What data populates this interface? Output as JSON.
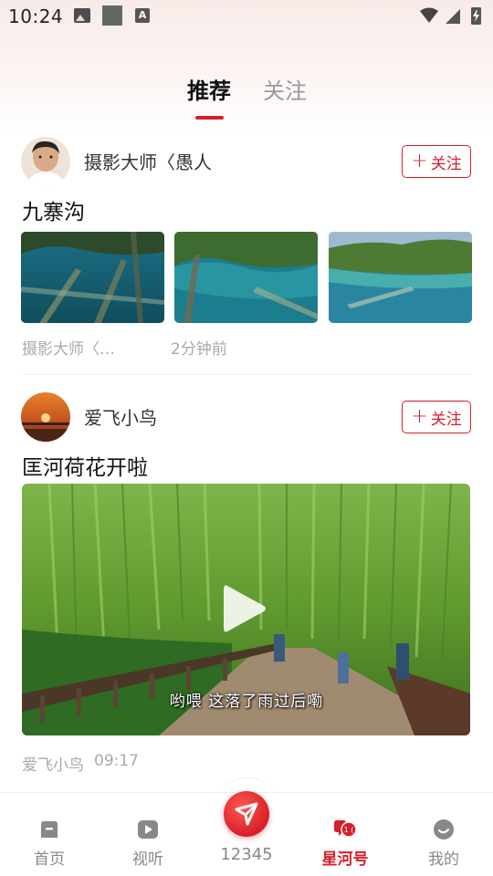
{
  "status_bar": {
    "time": "10:24"
  },
  "tabs": [
    {
      "label": "推荐",
      "active": true
    },
    {
      "label": "关注",
      "active": false
    }
  ],
  "posts": [
    {
      "author": "摄影大师〈愚人",
      "follow_label": "关注",
      "title": "九寨沟",
      "meta_author": "摄影大师〈…",
      "meta_time": "2分钟前"
    },
    {
      "author": "爱飞小鸟",
      "follow_label": "关注",
      "title": "匡河荷花开啦",
      "video_subtitle": "哟喂 这落了雨过后嘞",
      "meta_author": "爱飞小鸟",
      "meta_time": "09:17"
    }
  ],
  "bottom_nav": [
    {
      "label": "首页",
      "icon": "home-icon"
    },
    {
      "label": "视听",
      "icon": "play-icon"
    },
    {
      "label": "12345",
      "icon": "paper-plane-icon"
    },
    {
      "label": "星河号",
      "icon": "chat-bubble-icon",
      "active": true
    },
    {
      "label": "我的",
      "icon": "profile-icon"
    }
  ],
  "colors": {
    "accent": "#d81e2a",
    "muted": "#999999"
  }
}
